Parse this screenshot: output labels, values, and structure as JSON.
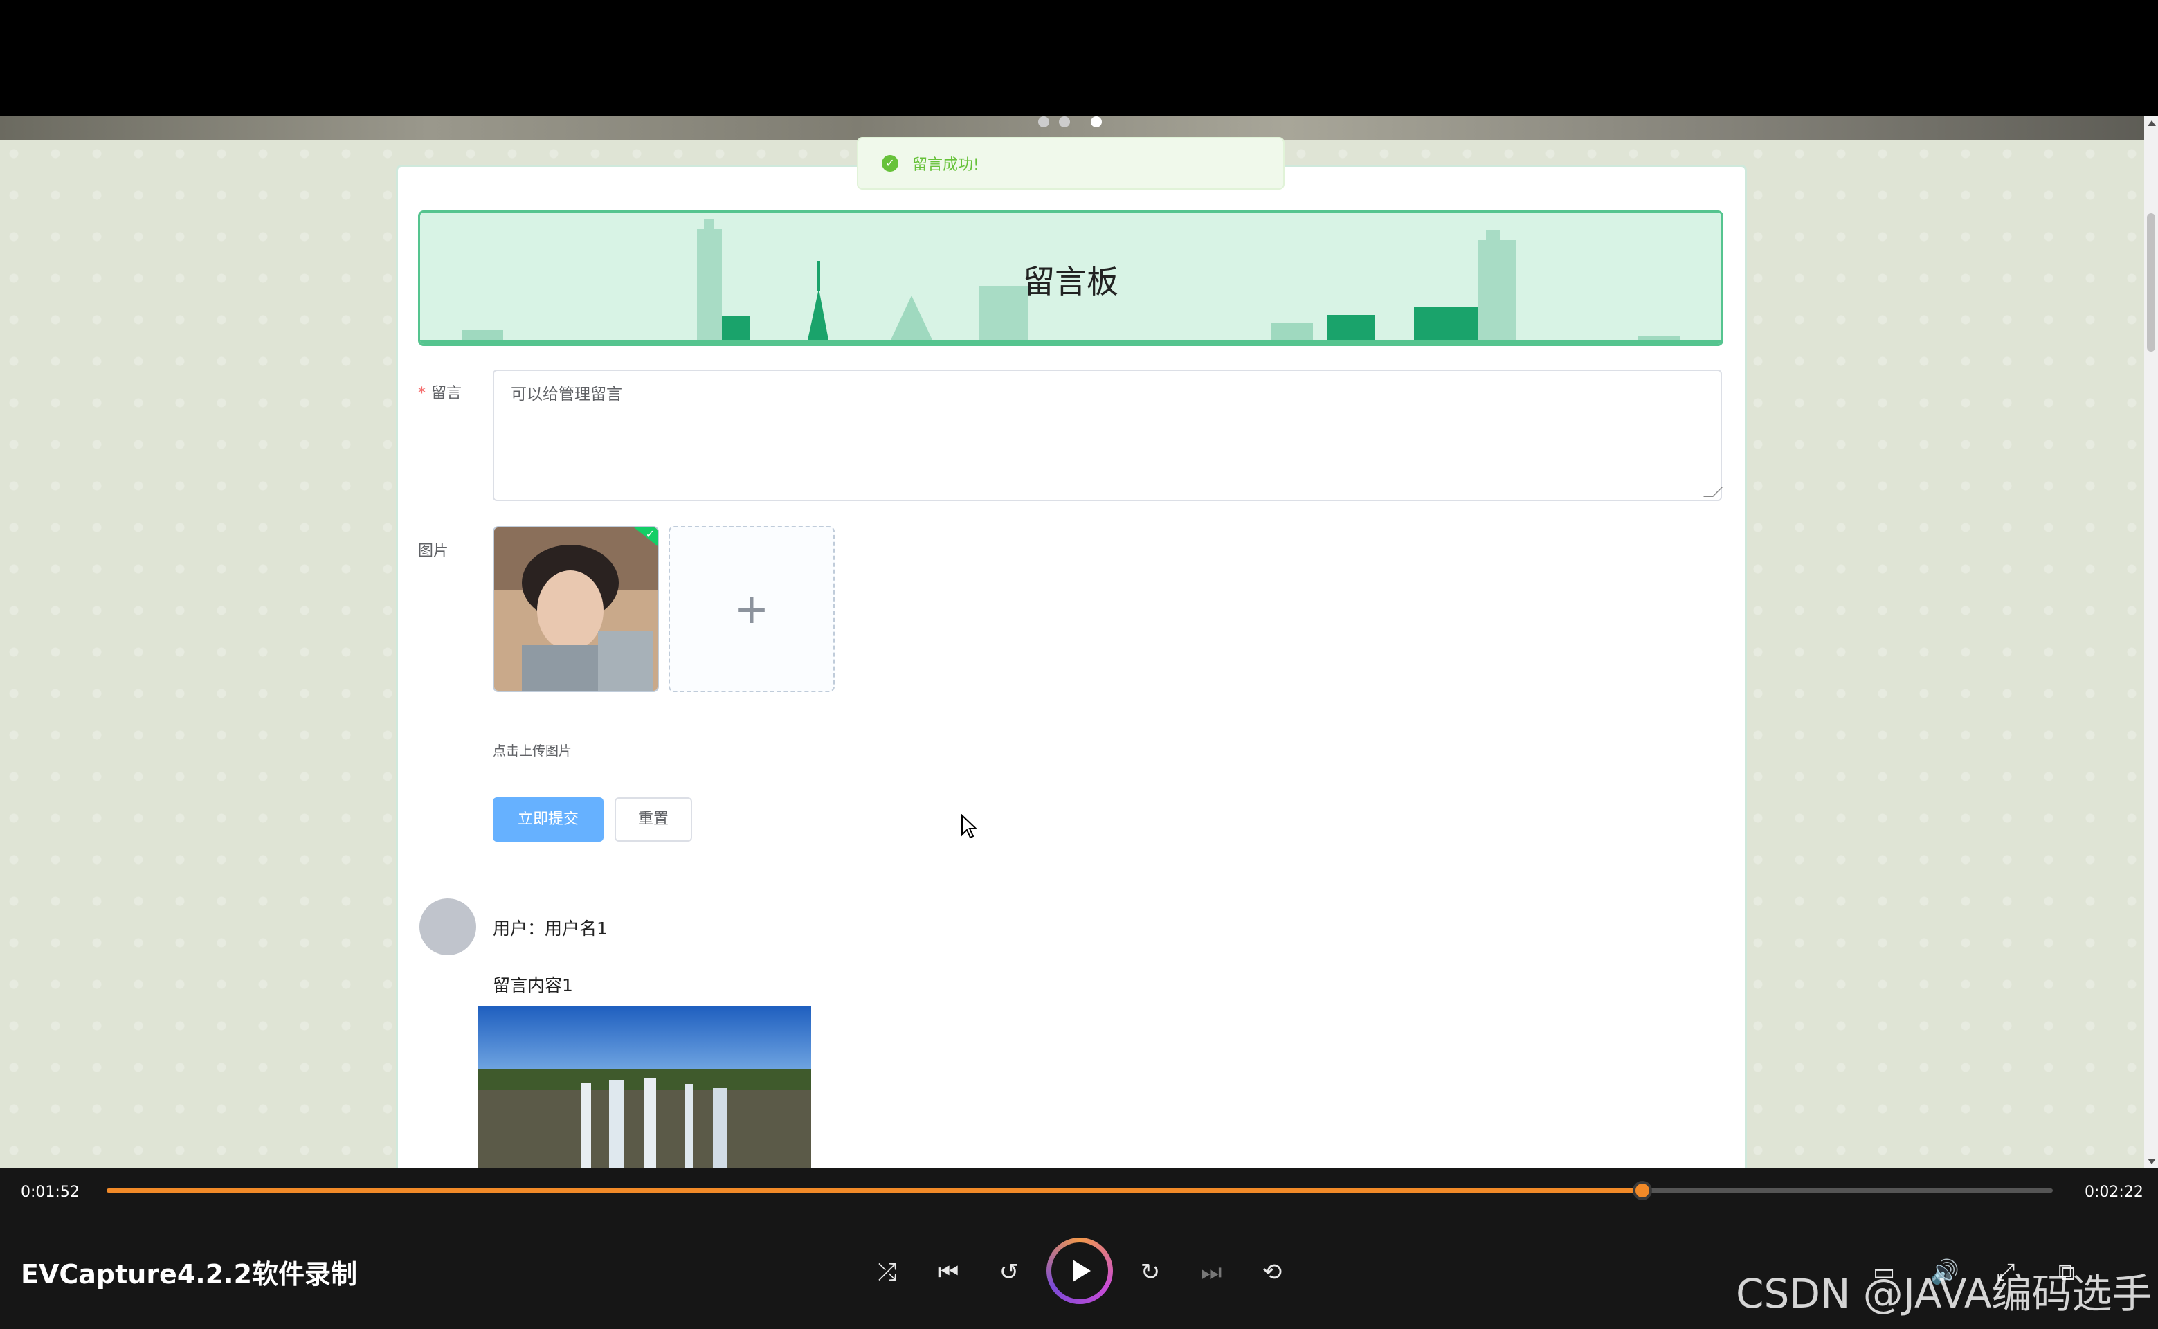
{
  "toast": {
    "text": "留言成功!",
    "icon": "check-circle-icon",
    "color": "#67c23a"
  },
  "board": {
    "title": "留言板"
  },
  "form": {
    "message_label": "留言",
    "required_mark": "*",
    "message_placeholder": "可以给管理留言",
    "image_label": "图片",
    "upload_tip": "点击上传图片",
    "submit_label": "立即提交",
    "reset_label": "重置"
  },
  "comment": {
    "user_text": "用户：用户名1",
    "content": "留言内容1"
  },
  "player": {
    "elapsed": "0:01:52",
    "total": "0:02:22",
    "progress": 0.789,
    "title": "EVCapture4.2.2软件录制",
    "accent": "#f28a28"
  },
  "watermark": "CSDN @JAVA编码选手",
  "colors": {
    "primary_button": "#66b1ff",
    "board_border": "#55c48f",
    "board_bg": "#d8f3e5"
  }
}
